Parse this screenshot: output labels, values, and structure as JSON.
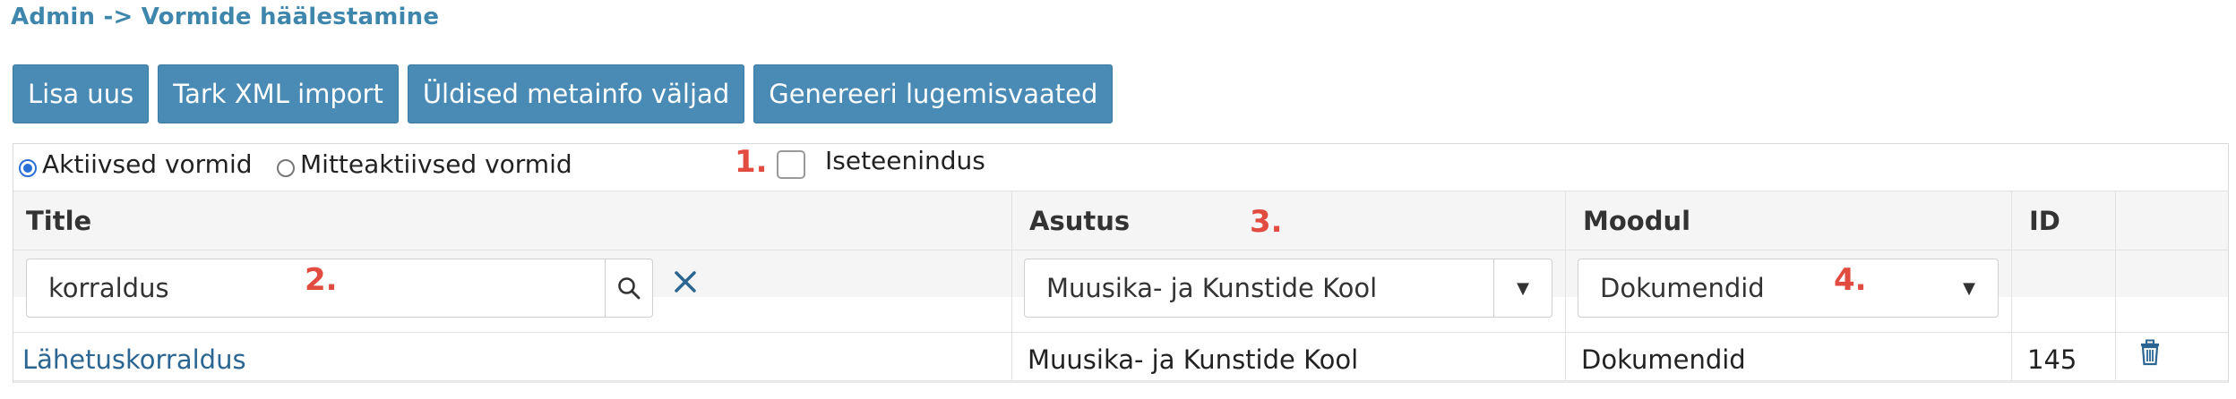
{
  "breadcrumb": "Admin -> Vormide häälestamine",
  "toolbar": {
    "add_new": "Lisa uus",
    "smart_xml_import": "Tark XML import",
    "general_metainfo_fields": "Üldised metainfo väljad",
    "generate_reading_views": "Genereeri lugemisvaated"
  },
  "filters": {
    "active_label": "Aktiivsed vormid",
    "inactive_label": "Mitteaktiivsed vormid",
    "active_selected": true,
    "self_service_label": "Iseteenindus",
    "self_service_checked": false
  },
  "annotations": [
    "1.",
    "2.",
    "3.",
    "4."
  ],
  "columns": {
    "title": "Title",
    "institution": "Asutus",
    "module": "Moodul",
    "id": "ID"
  },
  "filter_inputs": {
    "title_value": "korraldus",
    "institution_value": "Muusika- ja Kunstide Kool",
    "module_value": "Dokumendid"
  },
  "rows": [
    {
      "title": "Lähetuskorraldus",
      "institution": "Muusika- ja Kunstide Kool",
      "module": "Dokumendid",
      "id": "145"
    }
  ],
  "colors": {
    "button_bg": "#4a8bb5",
    "breadcrumb": "#3f86ad",
    "annotation": "#e24b3f",
    "link": "#2b6592"
  }
}
